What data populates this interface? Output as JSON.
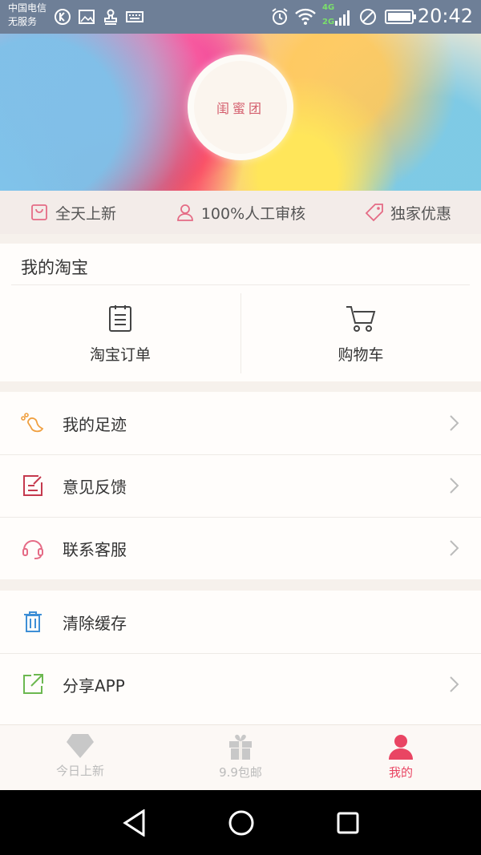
{
  "status_bar": {
    "carrier_line1": "中国电信",
    "carrier_line2": "无服务",
    "network_badge_top": "4G",
    "network_badge_bottom": "2G",
    "time": "20:42"
  },
  "hero": {
    "logo_text": "闺蜜团"
  },
  "features": [
    {
      "label": "全天上新",
      "icon": "bag-icon"
    },
    {
      "label": "100%人工审核",
      "icon": "person-icon"
    },
    {
      "label": "独家优惠",
      "icon": "tag-icon"
    }
  ],
  "my_taobao": {
    "title": "我的淘宝",
    "items": [
      {
        "label": "淘宝订单",
        "icon": "order-icon"
      },
      {
        "label": "购物车",
        "icon": "cart-icon"
      }
    ]
  },
  "menu_group1": [
    {
      "label": "我的足迹",
      "icon": "footprint-icon"
    },
    {
      "label": "意见反馈",
      "icon": "feedback-icon"
    },
    {
      "label": "联系客服",
      "icon": "headset-icon"
    }
  ],
  "menu_group2": [
    {
      "label": "清除缓存",
      "icon": "trash-icon"
    },
    {
      "label": "分享APP",
      "icon": "share-icon"
    }
  ],
  "tabbar": [
    {
      "label": "今日上新",
      "icon": "diamond-icon",
      "active": false
    },
    {
      "label": "9.9包邮",
      "icon": "gift-icon",
      "active": false
    },
    {
      "label": "我的",
      "icon": "person-icon",
      "active": true
    }
  ],
  "colors": {
    "accent": "#e94563",
    "status_bar": "#6e7f97"
  }
}
